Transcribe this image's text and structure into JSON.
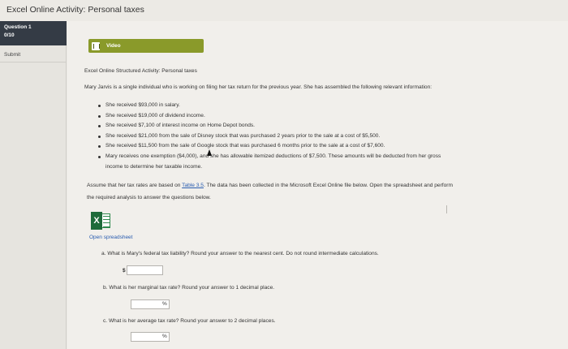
{
  "page_title": "Excel Online Activity: Personal taxes",
  "left_panel": {
    "question_label": "Question 1",
    "score": "0/10",
    "submit": "Submit"
  },
  "video": {
    "label": "Video",
    "icon": "film-icon"
  },
  "activity_title": "Excel Online Structured Activity: Personal taxes",
  "intro": "Mary Jarvis is a single individual who is working on filing her tax return for the previous year. She has assembled the following relevant information:",
  "bullets": [
    "She received $93,000 in salary.",
    "She received $19,000 of dividend income.",
    "She received $7,100 of interest income on Home Depot bonds.",
    "She received $21,000 from the sale of Disney stock that was purchased 2 years prior to the sale at a cost of $5,500.",
    "She received $11,500 from the sale of Google stock that was purchased 6 months prior to the sale at a cost of $7,600.",
    "Mary receives one exemption ($4,000), and she has allowable itemized deductions of $7,500. These amounts will be deducted from her gross"
  ],
  "bullet_continuation": "income to determine her taxable income.",
  "assume_part1": "Assume that her tax rates are based on ",
  "assume_link": "Table 3.5",
  "assume_part2": ". The data has been collected in the Microsoft Excel Online file below. Open the spreadsheet and perform",
  "assume_line2": "the required analysis to answer the questions below.",
  "excel_icon_letter": "X",
  "open_spreadsheet": "Open spreadsheet",
  "questions": {
    "a": "a. What is Mary's federal tax liability? Round your answer to the nearest cent. Do not round intermediate calculations.",
    "b": "b. What is her marginal tax rate? Round your answer to 1 decimal place.",
    "c": "c. What is her average tax rate? Round your answer to 2 decimal places."
  },
  "units": {
    "dollar": "$",
    "percent": "%"
  },
  "answers": {
    "a": "",
    "b": "",
    "c": ""
  },
  "colors": {
    "video_button": "#8a9a2a",
    "question_box": "#343b45",
    "link": "#2a5db0",
    "excel_green": "#1e6b3a"
  }
}
